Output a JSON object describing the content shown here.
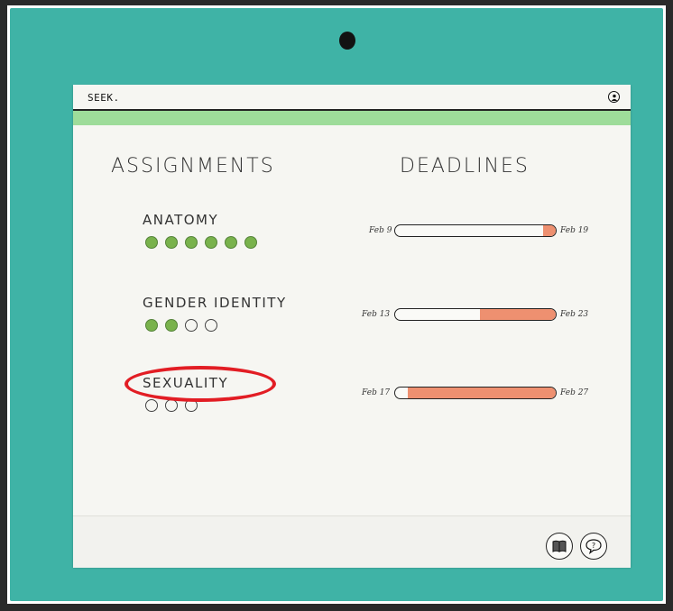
{
  "app": {
    "brand": "SEEK."
  },
  "headings": {
    "assignments": "ASSIGNMENTS",
    "deadlines": "DEADLINES"
  },
  "assignments": [
    {
      "name": "ANATOMY",
      "done": 6,
      "total": 6,
      "start": "Feb 9",
      "end": "Feb 19",
      "progress": 0.08
    },
    {
      "name": "GENDER IDENTITY",
      "done": 2,
      "total": 4,
      "start": "Feb 13",
      "end": "Feb 23",
      "progress": 0.47
    },
    {
      "name": "SEXUALITY",
      "done": 0,
      "total": 3,
      "start": "Feb 17",
      "end": "Feb 27",
      "progress": 0.92
    }
  ],
  "icons": {
    "profile": "user-icon",
    "book": "book-icon",
    "help": "help-icon"
  },
  "colors": {
    "board": "#3fb3a6",
    "header_bar": "#9edc9a",
    "progress_fill": "#ee9070",
    "dot_done": "#79b24c",
    "highlight": "#e21d24"
  }
}
